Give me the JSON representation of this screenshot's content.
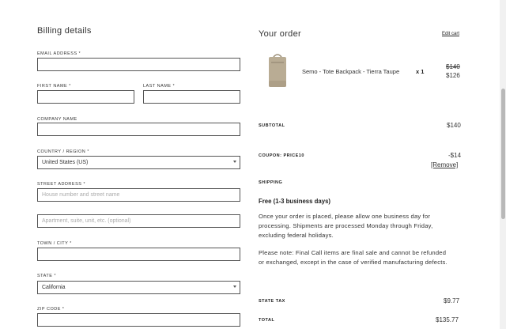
{
  "billing": {
    "title": "Billing details",
    "email_label": "EMAIL ADDRESS",
    "first_name_label": "FIRST NAME",
    "last_name_label": "LAST NAME",
    "company_label": "COMPANY NAME",
    "country_label": "COUNTRY / REGION",
    "country_value": "United States (US)",
    "street_label": "STREET ADDRESS",
    "street_placeholder": "House number and street name",
    "apartment_placeholder": "Apartment, suite, unit, etc. (optional)",
    "town_label": "TOWN / CITY",
    "state_label": "STATE",
    "state_value": "California",
    "zip_label": "ZIP CODE",
    "required_mark": "*"
  },
  "order": {
    "title": "Your order",
    "edit_cart": "Edit cart",
    "product_name": "Semo - Tote Backpack - Tierra Taupe",
    "product_qty": "x 1",
    "price_old": "$140",
    "price_new": "$126",
    "subtotal_label": "SUBTOTAL",
    "subtotal_value": "$140",
    "coupon_label": "COUPON: PRICE10",
    "coupon_value": "-$14",
    "coupon_remove": "[Remove]",
    "shipping_label": "SHIPPING",
    "shipping_method": "Free (1-3 business days)",
    "shipping_note": "Once your order is placed, please allow one business day for processing. Shipments are processed Monday through Friday, excluding federal holidays.",
    "final_note": "Please note: Final Call items are final sale and cannot be refunded or exchanged, except in the case of verified manufacturing defects.",
    "tax_label": "STATE TAX",
    "tax_value": "$9.77",
    "total_label": "TOTAL",
    "total_value": "$135.77"
  },
  "colors": {
    "border": "#555555",
    "text": "#222222",
    "placeholder": "#aaaaaa",
    "product": "#b9ac94"
  }
}
